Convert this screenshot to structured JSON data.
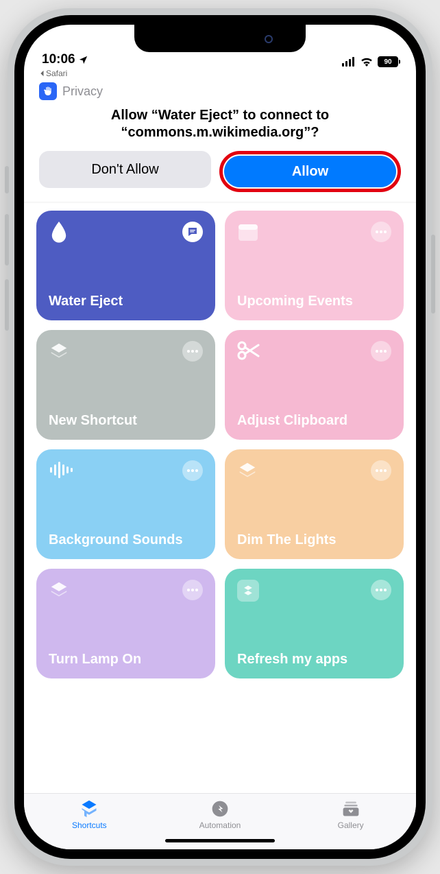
{
  "status": {
    "time": "10:06",
    "back_app": "Safari",
    "battery": "90"
  },
  "privacy": {
    "label": "Privacy",
    "prompt_l1": "Allow “Water Eject” to connect to",
    "prompt_l2": "“commons.m.wikimedia.org”?",
    "deny": "Don't Allow",
    "allow": "Allow"
  },
  "tiles": [
    {
      "label": "Water Eject",
      "icon": "water-drop",
      "color": "t-blue",
      "menu": "bubble"
    },
    {
      "label": "Upcoming Events",
      "icon": "calendar",
      "color": "t-pink",
      "menu": "dots"
    },
    {
      "label": "New Shortcut",
      "icon": "layers",
      "color": "t-grey",
      "menu": "dots"
    },
    {
      "label": "Adjust Clipboard",
      "icon": "scissors",
      "color": "t-pink2",
      "menu": "dots"
    },
    {
      "label": "Background Sounds",
      "icon": "waveform",
      "color": "t-sky",
      "menu": "dots"
    },
    {
      "label": "Dim The Lights",
      "icon": "layers",
      "color": "t-peach",
      "menu": "dots"
    },
    {
      "label": "Turn Lamp On",
      "icon": "layers",
      "color": "t-lilac",
      "menu": "dots"
    },
    {
      "label": "Refresh my apps",
      "icon": "shortcuts-badge",
      "color": "t-teal",
      "menu": "dots"
    }
  ],
  "tabs": {
    "shortcuts": "Shortcuts",
    "automation": "Automation",
    "gallery": "Gallery"
  }
}
